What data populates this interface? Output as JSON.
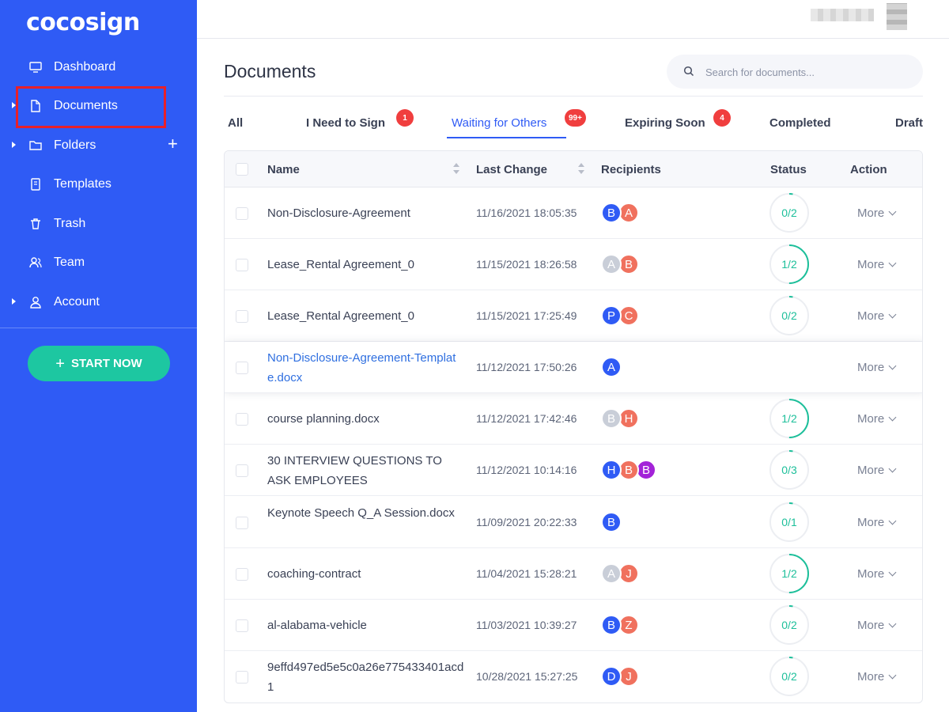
{
  "brand": {
    "logo_text": "cocosign"
  },
  "sidebar": {
    "items": [
      {
        "label": "Dashboard",
        "icon": "monitor-icon"
      },
      {
        "label": "Documents",
        "icon": "document-icon"
      },
      {
        "label": "Folders",
        "icon": "folder-icon"
      },
      {
        "label": "Templates",
        "icon": "template-icon"
      },
      {
        "label": "Trash",
        "icon": "trash-icon"
      },
      {
        "label": "Team",
        "icon": "team-icon"
      },
      {
        "label": "Account",
        "icon": "user-icon"
      }
    ],
    "folders_add": "+",
    "start_button": {
      "plus": "+",
      "label": "START NOW"
    }
  },
  "header": {
    "title": "Documents",
    "search_placeholder": "Search for documents..."
  },
  "tabs": [
    {
      "label": "All",
      "badge": ""
    },
    {
      "label": "I Need to Sign",
      "badge": "1"
    },
    {
      "label": "Waiting for Others",
      "badge": "99+",
      "active": true
    },
    {
      "label": "Expiring Soon",
      "badge": "4"
    },
    {
      "label": "Completed",
      "badge": ""
    },
    {
      "label": "Draft",
      "badge": ""
    }
  ],
  "table": {
    "columns": [
      "Name",
      "Last Change",
      "Recipients",
      "Status",
      "Action"
    ],
    "action_label": "More",
    "colors": {
      "blue": "#2f5bf5",
      "coral": "#f0715e",
      "gray": "#c9ced8",
      "purple": "#a323d8",
      "progress": "#1cbf9a",
      "track": "#eceef2"
    },
    "rows": [
      {
        "name": "Non-Disclosure-Agreement",
        "date": "11/16/2021 18:05:35",
        "recipients": [
          {
            "l": "B",
            "c": "blue"
          },
          {
            "l": "A",
            "c": "coral"
          }
        ],
        "status": "0/2",
        "done": 0,
        "total": 2
      },
      {
        "name": "Lease_Rental Agreement_0",
        "date": "11/15/2021 18:26:58",
        "recipients": [
          {
            "l": "A",
            "c": "gray"
          },
          {
            "l": "B",
            "c": "coral"
          }
        ],
        "status": "1/2",
        "done": 1,
        "total": 2
      },
      {
        "name": "Lease_Rental Agreement_0",
        "date": "11/15/2021 17:25:49",
        "recipients": [
          {
            "l": "P",
            "c": "blue"
          },
          {
            "l": "C",
            "c": "coral"
          }
        ],
        "status": "0/2",
        "done": 0,
        "total": 2
      },
      {
        "name": "Non-Disclosure-Agreement-Template.docx",
        "date": "11/12/2021 17:50:26",
        "recipients": [
          {
            "l": "A",
            "c": "blue"
          }
        ],
        "status": "",
        "done": 0,
        "total": 0,
        "link": true,
        "highlight": true
      },
      {
        "name": "course planning.docx",
        "date": "11/12/2021 17:42:46",
        "recipients": [
          {
            "l": "B",
            "c": "gray"
          },
          {
            "l": "H",
            "c": "coral"
          }
        ],
        "status": "1/2",
        "done": 1,
        "total": 2
      },
      {
        "name": "30 INTERVIEW QUESTIONS TO ASK EMPLOYEES",
        "date": "11/12/2021 10:14:16",
        "recipients": [
          {
            "l": "H",
            "c": "blue"
          },
          {
            "l": "B",
            "c": "coral"
          },
          {
            "l": "B",
            "c": "purple"
          }
        ],
        "status": "0/3",
        "done": 0,
        "total": 3
      },
      {
        "name": "Keynote Speech Q_A Session.docx",
        "date": "11/09/2021 20:22:33",
        "recipients": [
          {
            "l": "B",
            "c": "blue"
          }
        ],
        "status": "0/1",
        "done": 0,
        "total": 1
      },
      {
        "name": "coaching-contract",
        "date": "11/04/2021 15:28:21",
        "recipients": [
          {
            "l": "A",
            "c": "gray"
          },
          {
            "l": "J",
            "c": "coral"
          }
        ],
        "status": "1/2",
        "done": 1,
        "total": 2
      },
      {
        "name": "al-alabama-vehicle",
        "date": "11/03/2021 10:39:27",
        "recipients": [
          {
            "l": "B",
            "c": "blue"
          },
          {
            "l": "Z",
            "c": "coral"
          }
        ],
        "status": "0/2",
        "done": 0,
        "total": 2
      },
      {
        "name": "9effd497ed5e5c0a26e775433401acd1",
        "date": "10/28/2021 15:27:25",
        "recipients": [
          {
            "l": "D",
            "c": "blue"
          },
          {
            "l": "J",
            "c": "coral"
          }
        ],
        "status": "0/2",
        "done": 0,
        "total": 2
      }
    ]
  }
}
